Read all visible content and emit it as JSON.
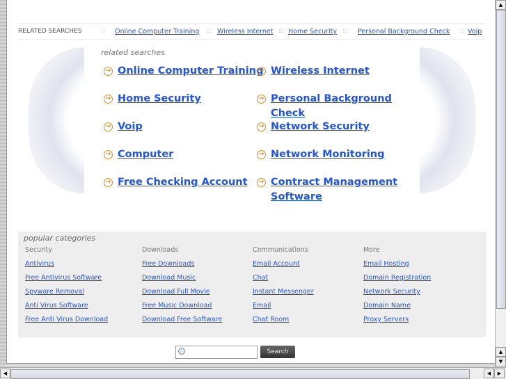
{
  "related_bar": {
    "label": "RELATED SEARCHES",
    "separator": "::",
    "links": [
      "Online Computer Training",
      "Wireless Internet",
      "Home Security",
      "Personal Background Check",
      "Voip"
    ]
  },
  "related": {
    "title": "related searches",
    "links": [
      "Online Computer Training",
      "Wireless Internet",
      "Home Security",
      "Personal Background Check",
      "Voip",
      "Network Security",
      "Computer",
      "Network Monitoring",
      "Free Checking Account",
      "Contract Management Software"
    ]
  },
  "popular": {
    "title": "popular categories",
    "columns": [
      {
        "header": "Security",
        "links": [
          "Antivirus",
          "Free Antivirus Software",
          "Spyware Removal",
          "Anti Virus Software",
          "Free Anti Virus Download"
        ]
      },
      {
        "header": "Downloads",
        "links": [
          "Free Downloads",
          "Download Music",
          "Download Full Movie",
          "Free Music Download",
          "Download Free Software"
        ]
      },
      {
        "header": "Communications",
        "links": [
          "Email Account",
          "Chat",
          "Instant Messenger",
          "Email",
          "Chat Room"
        ]
      },
      {
        "header": "More",
        "links": [
          "Email Hosting",
          "Domain Registration",
          "Network Security",
          "Domain Name",
          "Proxy Servers"
        ]
      }
    ]
  },
  "search": {
    "value": "",
    "button": "Search"
  },
  "icons": {
    "arrow": "→",
    "search": "magnifier"
  }
}
